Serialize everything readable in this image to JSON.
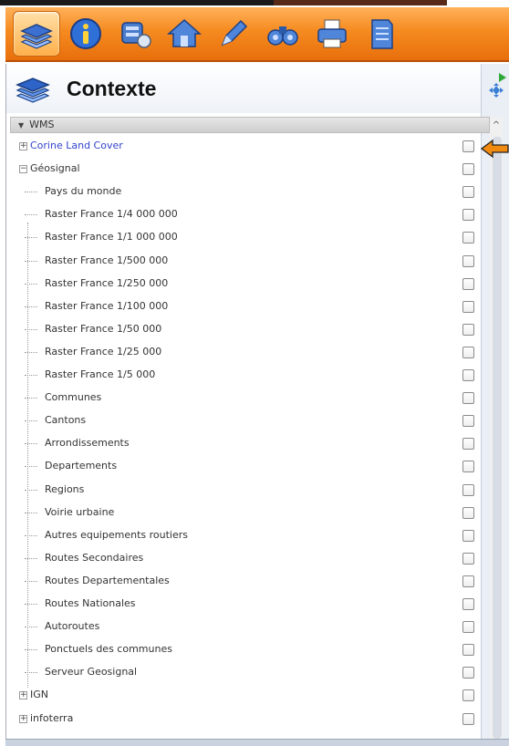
{
  "toolbar": {
    "buttons": [
      {
        "name": "layers-icon",
        "active": true
      },
      {
        "name": "info-icon",
        "active": false
      },
      {
        "name": "database-icon",
        "active": false
      },
      {
        "name": "home-icon",
        "active": false
      },
      {
        "name": "pen-icon",
        "active": false
      },
      {
        "name": "binoculars-icon",
        "active": false
      },
      {
        "name": "printer-icon",
        "active": false
      },
      {
        "name": "document-icon",
        "active": false
      }
    ]
  },
  "panel": {
    "title": "Contexte"
  },
  "section": {
    "label": "WMS"
  },
  "tree": {
    "top_nodes": [
      {
        "label": "Corine Land Cover",
        "expander": "+"
      },
      {
        "label": "Géosignal",
        "expander": "−"
      }
    ],
    "children": [
      "Pays du monde",
      "Raster France 1/4 000 000",
      "Raster France 1/1 000 000",
      "Raster France 1/500 000",
      "Raster France 1/250 000",
      "Raster France 1/100 000",
      "Raster France 1/50 000",
      "Raster France 1/25 000",
      "Raster France 1/5 000",
      "Communes",
      "Cantons",
      "Arrondissements",
      "Departements",
      "Regions",
      "Voirie urbaine",
      "Autres equipements routiers",
      "Routes Secondaires",
      "Routes Departementales",
      "Routes Nationales",
      "Autoroutes",
      "Ponctuels des communes",
      "Serveur Geosignal"
    ],
    "bottom_nodes": [
      {
        "label": "IGN",
        "expander": "+"
      },
      {
        "label": "infoterra",
        "expander": "+"
      }
    ]
  },
  "colors": {
    "toolbar_orange": "#f58a1f",
    "link_blue": "#3344cc",
    "annotation_arrow": "#f08a10"
  }
}
